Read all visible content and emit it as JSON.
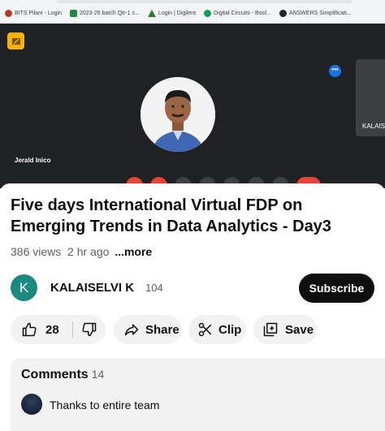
{
  "bookmarks": [
    {
      "label": "BITS Pilani - Login",
      "icon": "bits-pilani-favicon",
      "color": "#b23b2e"
    },
    {
      "label": "2023-26 batch Qtr-1 c...",
      "icon": "sheets-favicon",
      "color": "#1e8e3e"
    },
    {
      "label": "Login | Digilent",
      "icon": "digilent-favicon",
      "color": "#2e7d32"
    },
    {
      "label": "Digital Circuits - Bool...",
      "icon": "circuit-favicon",
      "color": "#0f9d58"
    },
    {
      "label": "ANSWERS Simplificati...",
      "icon": "globe-favicon",
      "color": "#202124"
    }
  ],
  "meeting": {
    "participant_name": "Jerald Inico",
    "side_participant": "KALAIS",
    "accent": "#1a73e8"
  },
  "video": {
    "title": "Five days International Virtual FDP on Emerging Trends in Data Analytics - Day3",
    "views": "386 views",
    "age": "2 hr ago",
    "more": "...more"
  },
  "channel": {
    "avatar_letter": "K",
    "name": "KALAISELVI K",
    "subscribers": "104",
    "subscribe_label": "Subscribe",
    "avatar_color": "#1a8a7f"
  },
  "actions": {
    "likes": "28",
    "share": "Share",
    "clip": "Clip",
    "save": "Save"
  },
  "comments": {
    "heading": "Comments",
    "count": "14",
    "first_comment": "Thanks to entire team"
  }
}
